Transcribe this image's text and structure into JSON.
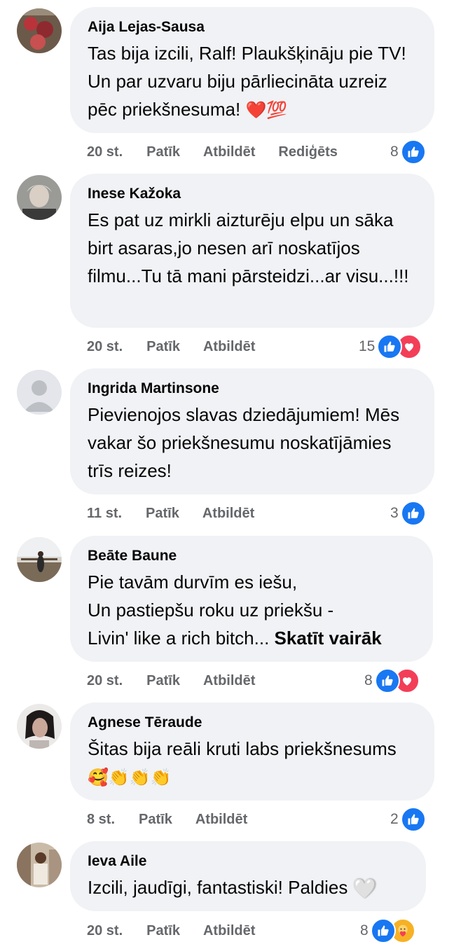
{
  "comments": [
    {
      "author": "Aija Lejas-Sausa",
      "text": "Tas bija izcili, Ralf! Plaukšķināju pie TV! Un par uzvaru biju pārliecināta uzreiz pēc priekšnesuma! ",
      "emoji": "❤️💯",
      "time": "20 st.",
      "like_label": "Patīk",
      "reply_label": "Atbildēt",
      "edited_label": "Rediģēts",
      "reaction_count": "8",
      "reactions": [
        "like-icon"
      ]
    },
    {
      "author": "Inese Kažoka",
      "text": "Es pat uz mirkli aizturēju elpu un sāka birt asaras,jo nesen arī noskatījos filmu...Tu tā mani pārsteidzi...ar visu...!!!",
      "time": "20 st.",
      "like_label": "Patīk",
      "reply_label": "Atbildēt",
      "reaction_count": "15",
      "reactions": [
        "like-icon",
        "love-icon"
      ]
    },
    {
      "author": "Ingrida Martinsone",
      "text": "Pievienojos slavas dziedājumiem! Mēs vakar šo priekšnesumu noskatījāmies trīs reizes!",
      "time": "11 st.",
      "like_label": "Patīk",
      "reply_label": "Atbildēt",
      "reaction_count": "3",
      "reactions": [
        "like-icon"
      ]
    },
    {
      "author": "Beāte Baune",
      "line1": "Pie tavām durvīm es iešu,",
      "line2": "Un pastiepšu roku uz priekšu -",
      "line3": "Livin' like a rich bitch... ",
      "see_more": "Skatīt vairāk",
      "time": "20 st.",
      "like_label": "Patīk",
      "reply_label": "Atbildēt",
      "reaction_count": "8",
      "reactions": [
        "like-icon",
        "love-icon"
      ]
    },
    {
      "author": "Agnese Tēraude",
      "text": "Šitas bija reāli kruti labs priekšnesums",
      "emoji": "🥰👏👏👏",
      "time": "8 st.",
      "like_label": "Patīk",
      "reply_label": "Atbildēt",
      "reaction_count": "2",
      "reactions": [
        "like-icon"
      ]
    },
    {
      "author": "Ieva Aile",
      "text": "Izcili, jaudīgi, fantastiski! Paldies ",
      "emoji": "🤍",
      "time": "20 st.",
      "like_label": "Patīk",
      "reply_label": "Atbildēt",
      "reaction_count": "8",
      "reactions": [
        "like-icon",
        "care-icon"
      ]
    }
  ],
  "colors": {
    "bubble": "#f0f2f5",
    "meta_text": "#65676b",
    "like_blue": "#1877f2",
    "love_red": "#f33e58",
    "care_yellow": "#f7b125"
  }
}
